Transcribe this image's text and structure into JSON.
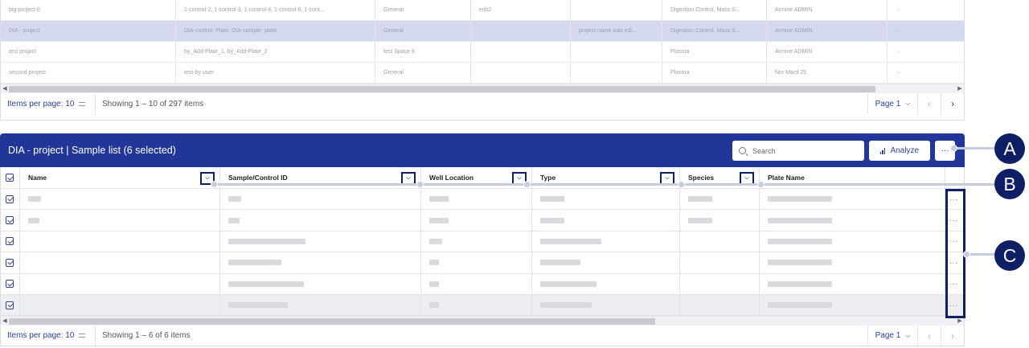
{
  "top_table": {
    "rows": [
      [
        "big-project-0",
        "1-control-2, 1-control-3, 1-control-4, 1-control-6, 1-cont...",
        "General",
        "edit2",
        "",
        "Digestion Control, Mass S...",
        "Armine ADMIN",
        "···"
      ],
      [
        "DIA - project",
        "DIA-control- Plate, DIA-sample- plate",
        "General",
        "",
        "project name was edi...",
        "Digestion Control, Mass S...",
        "Armine ADMIN",
        "···"
      ],
      [
        "test project",
        "by_Add-Plate_1, by_Add-Plate_2",
        "test Space 6",
        "",
        "",
        "Plasma",
        "Armine ADMIN",
        "···"
      ],
      [
        "second-project",
        "test-by user",
        "General",
        "",
        "",
        "Plasma",
        "Nor Mard 25",
        "···"
      ]
    ],
    "selected_row": 1
  },
  "top_pager": {
    "items_per_page": "Items per page: 10",
    "showing": "Showing 1 – 10 of 297 items",
    "page": "Page 1"
  },
  "sample_list": {
    "title": "DIA - project | Sample list (6 selected)",
    "search_placeholder": "Search",
    "analyze_label": "Analyze",
    "more_label": "···",
    "columns": [
      "Name",
      "Sample/Control ID",
      "Well Location",
      "Type",
      "Species",
      "Plate Name"
    ],
    "row_count": 6,
    "row_more": "···"
  },
  "bottom_pager": {
    "items_per_page": "Items per page: 10",
    "showing": "Showing 1 – 6 of 6 items",
    "page": "Page 1"
  },
  "callouts": [
    "A",
    "B",
    "C"
  ],
  "colors": {
    "header_blue": "#22369a",
    "callout_navy": "#0f1f66",
    "selected_row": "#d4d9ee",
    "link_blue": "#2c3f9e"
  }
}
